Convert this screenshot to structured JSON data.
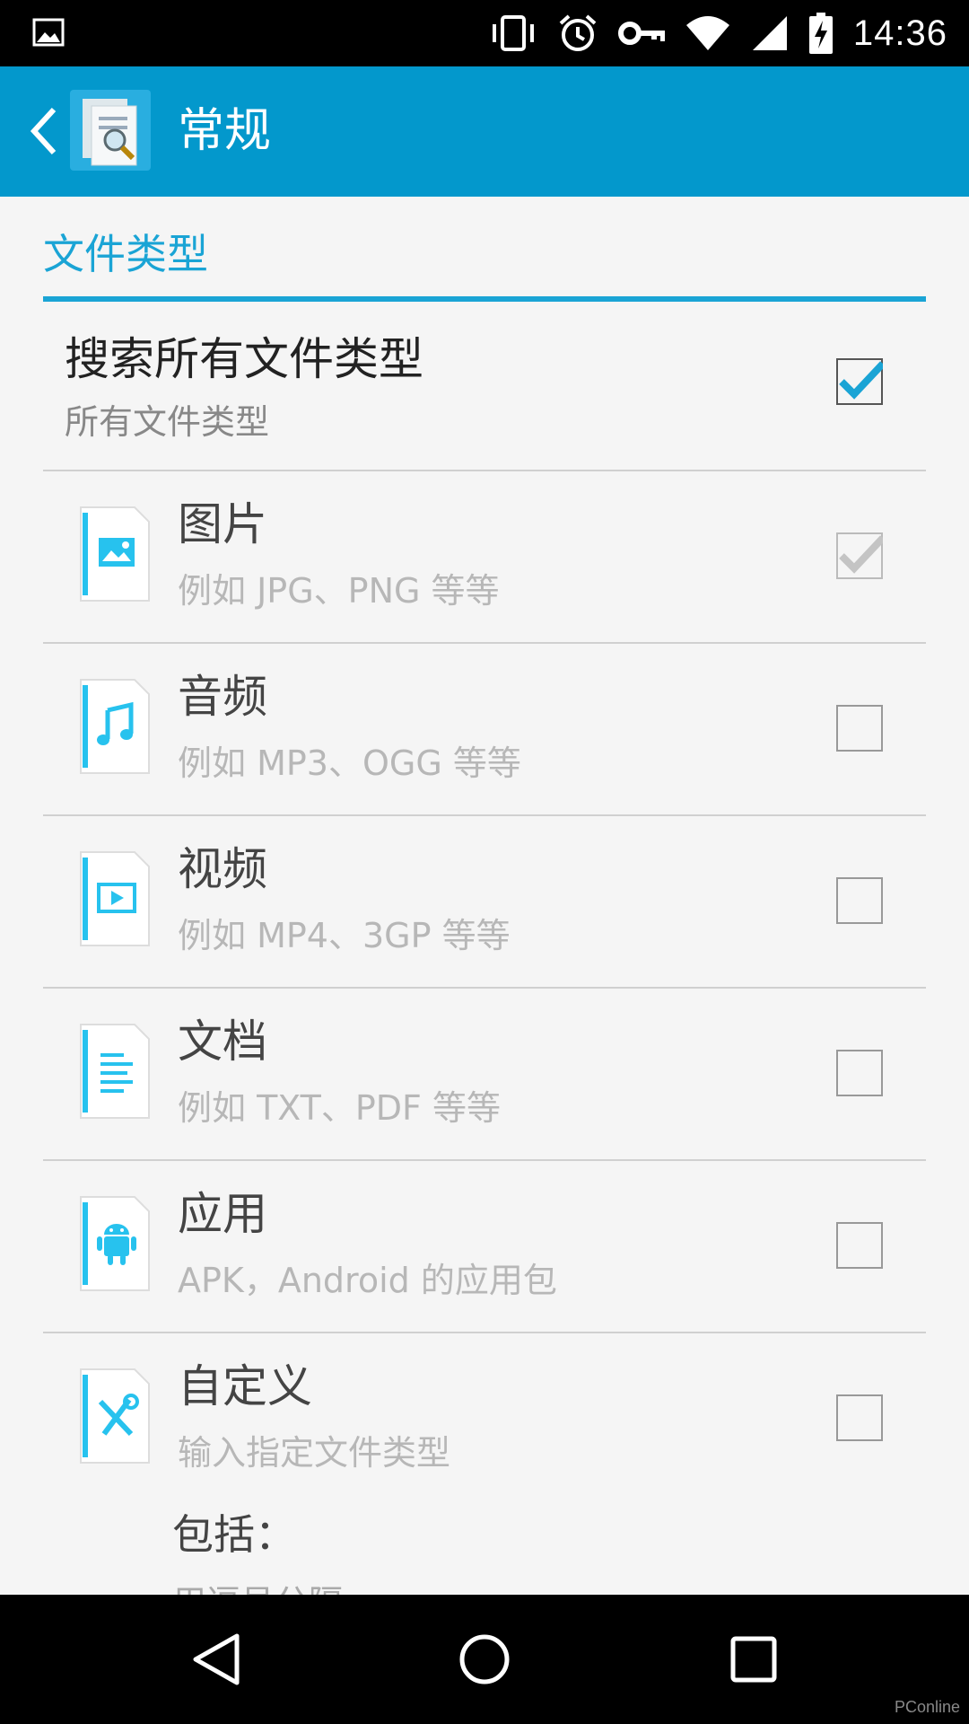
{
  "status_bar": {
    "time": "14:36",
    "icons": [
      "picture-icon",
      "vibrate-icon",
      "alarm-icon",
      "vpn-key-icon",
      "wifi-icon",
      "signal-icon",
      "battery-charging-icon"
    ]
  },
  "action_bar": {
    "title": "常规",
    "back_icon": "chevron-left-icon",
    "app_icon": "file-search-icon"
  },
  "category": {
    "title": "文件类型"
  },
  "search_all": {
    "title": "搜索所有文件类型",
    "summary": "所有文件类型",
    "checked": true
  },
  "file_types": [
    {
      "title": "图片",
      "summary": "例如 JPG、PNG 等等",
      "icon": "image-file-icon",
      "checked": true,
      "disabled": true
    },
    {
      "title": "音频",
      "summary": "例如 MP3、OGG 等等",
      "icon": "audio-file-icon",
      "checked": false
    },
    {
      "title": "视频",
      "summary": "例如 MP4、3GP 等等",
      "icon": "video-file-icon",
      "checked": false
    },
    {
      "title": "文档",
      "summary": "例如 TXT、PDF 等等",
      "icon": "document-file-icon",
      "checked": false
    },
    {
      "title": "应用",
      "summary": "APK，Android 的应用包",
      "icon": "android-file-icon",
      "checked": false
    },
    {
      "title": "自定义",
      "summary": "输入指定文件类型",
      "icon": "tools-file-icon",
      "checked": false
    }
  ],
  "include_label": "包括：",
  "include_cut_text": "用逗号分隔",
  "navigation": {
    "icons": [
      "back-triangle-icon",
      "home-circle-icon",
      "recents-square-icon"
    ]
  },
  "watermark": "PConline",
  "colors": {
    "accent": "#1aa4d5",
    "action_bar": "#0398cc",
    "background": "#f5f5f5"
  }
}
